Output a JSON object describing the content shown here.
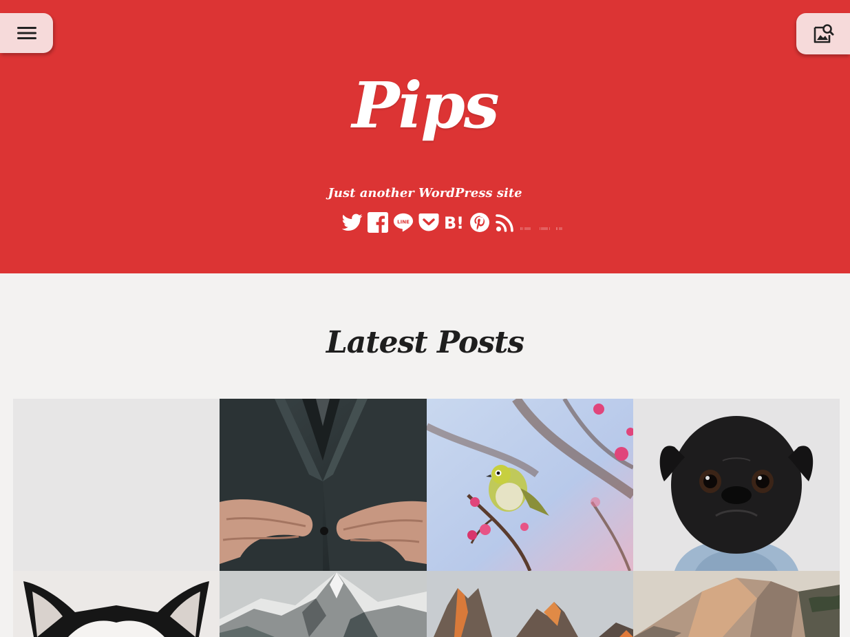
{
  "header": {
    "site_title": "Pips",
    "tagline": "Just another WordPress site",
    "background_color": "#dc3434",
    "menu_icon": "hamburger-menu-icon",
    "search_icon": "image-search-icon",
    "share_icons": [
      "twitter-icon",
      "facebook-icon",
      "line-icon",
      "pocket-icon",
      "hatena-bookmark-icon",
      "pinterest-icon",
      "rss-icon"
    ]
  },
  "main": {
    "section_title": "Latest Posts",
    "posts": [
      {
        "image": "blank-placeholder"
      },
      {
        "image": "man-buttoning-suit-jacket"
      },
      {
        "image": "yellow-bird-on-blossom-branch"
      },
      {
        "image": "black-pug-in-denim-jacket"
      },
      {
        "image": "husky-dog"
      },
      {
        "image": "snowy-mountain-peak"
      },
      {
        "image": "sunlit-rocky-peaks"
      },
      {
        "image": "granite-cliff-at-sunset"
      }
    ]
  }
}
